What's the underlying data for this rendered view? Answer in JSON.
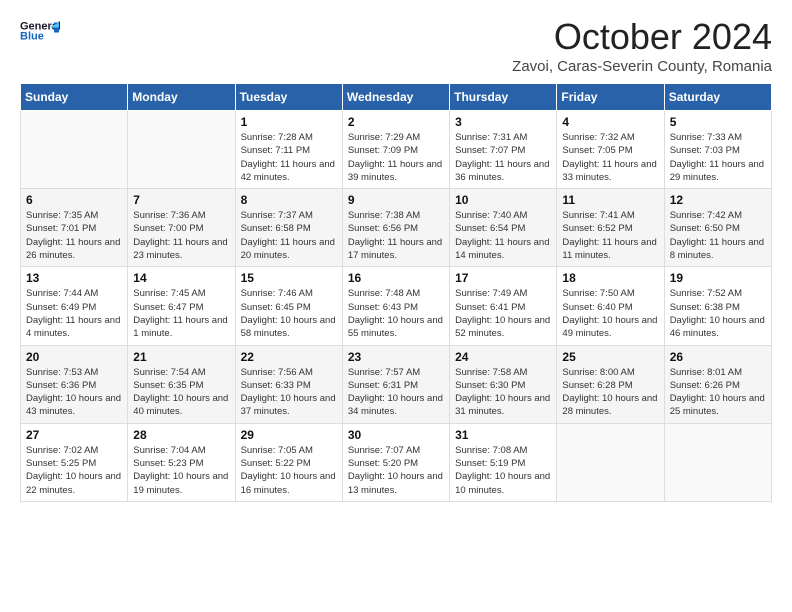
{
  "header": {
    "logo_general": "General",
    "logo_blue": "Blue",
    "month_title": "October 2024",
    "location": "Zavoi, Caras-Severin County, Romania"
  },
  "days_of_week": [
    "Sunday",
    "Monday",
    "Tuesday",
    "Wednesday",
    "Thursday",
    "Friday",
    "Saturday"
  ],
  "weeks": [
    [
      {
        "day": "",
        "sunrise": "",
        "sunset": "",
        "daylight": ""
      },
      {
        "day": "",
        "sunrise": "",
        "sunset": "",
        "daylight": ""
      },
      {
        "day": "1",
        "sunrise": "Sunrise: 7:28 AM",
        "sunset": "Sunset: 7:11 PM",
        "daylight": "Daylight: 11 hours and 42 minutes."
      },
      {
        "day": "2",
        "sunrise": "Sunrise: 7:29 AM",
        "sunset": "Sunset: 7:09 PM",
        "daylight": "Daylight: 11 hours and 39 minutes."
      },
      {
        "day": "3",
        "sunrise": "Sunrise: 7:31 AM",
        "sunset": "Sunset: 7:07 PM",
        "daylight": "Daylight: 11 hours and 36 minutes."
      },
      {
        "day": "4",
        "sunrise": "Sunrise: 7:32 AM",
        "sunset": "Sunset: 7:05 PM",
        "daylight": "Daylight: 11 hours and 33 minutes."
      },
      {
        "day": "5",
        "sunrise": "Sunrise: 7:33 AM",
        "sunset": "Sunset: 7:03 PM",
        "daylight": "Daylight: 11 hours and 29 minutes."
      }
    ],
    [
      {
        "day": "6",
        "sunrise": "Sunrise: 7:35 AM",
        "sunset": "Sunset: 7:01 PM",
        "daylight": "Daylight: 11 hours and 26 minutes."
      },
      {
        "day": "7",
        "sunrise": "Sunrise: 7:36 AM",
        "sunset": "Sunset: 7:00 PM",
        "daylight": "Daylight: 11 hours and 23 minutes."
      },
      {
        "day": "8",
        "sunrise": "Sunrise: 7:37 AM",
        "sunset": "Sunset: 6:58 PM",
        "daylight": "Daylight: 11 hours and 20 minutes."
      },
      {
        "day": "9",
        "sunrise": "Sunrise: 7:38 AM",
        "sunset": "Sunset: 6:56 PM",
        "daylight": "Daylight: 11 hours and 17 minutes."
      },
      {
        "day": "10",
        "sunrise": "Sunrise: 7:40 AM",
        "sunset": "Sunset: 6:54 PM",
        "daylight": "Daylight: 11 hours and 14 minutes."
      },
      {
        "day": "11",
        "sunrise": "Sunrise: 7:41 AM",
        "sunset": "Sunset: 6:52 PM",
        "daylight": "Daylight: 11 hours and 11 minutes."
      },
      {
        "day": "12",
        "sunrise": "Sunrise: 7:42 AM",
        "sunset": "Sunset: 6:50 PM",
        "daylight": "Daylight: 11 hours and 8 minutes."
      }
    ],
    [
      {
        "day": "13",
        "sunrise": "Sunrise: 7:44 AM",
        "sunset": "Sunset: 6:49 PM",
        "daylight": "Daylight: 11 hours and 4 minutes."
      },
      {
        "day": "14",
        "sunrise": "Sunrise: 7:45 AM",
        "sunset": "Sunset: 6:47 PM",
        "daylight": "Daylight: 11 hours and 1 minute."
      },
      {
        "day": "15",
        "sunrise": "Sunrise: 7:46 AM",
        "sunset": "Sunset: 6:45 PM",
        "daylight": "Daylight: 10 hours and 58 minutes."
      },
      {
        "day": "16",
        "sunrise": "Sunrise: 7:48 AM",
        "sunset": "Sunset: 6:43 PM",
        "daylight": "Daylight: 10 hours and 55 minutes."
      },
      {
        "day": "17",
        "sunrise": "Sunrise: 7:49 AM",
        "sunset": "Sunset: 6:41 PM",
        "daylight": "Daylight: 10 hours and 52 minutes."
      },
      {
        "day": "18",
        "sunrise": "Sunrise: 7:50 AM",
        "sunset": "Sunset: 6:40 PM",
        "daylight": "Daylight: 10 hours and 49 minutes."
      },
      {
        "day": "19",
        "sunrise": "Sunrise: 7:52 AM",
        "sunset": "Sunset: 6:38 PM",
        "daylight": "Daylight: 10 hours and 46 minutes."
      }
    ],
    [
      {
        "day": "20",
        "sunrise": "Sunrise: 7:53 AM",
        "sunset": "Sunset: 6:36 PM",
        "daylight": "Daylight: 10 hours and 43 minutes."
      },
      {
        "day": "21",
        "sunrise": "Sunrise: 7:54 AM",
        "sunset": "Sunset: 6:35 PM",
        "daylight": "Daylight: 10 hours and 40 minutes."
      },
      {
        "day": "22",
        "sunrise": "Sunrise: 7:56 AM",
        "sunset": "Sunset: 6:33 PM",
        "daylight": "Daylight: 10 hours and 37 minutes."
      },
      {
        "day": "23",
        "sunrise": "Sunrise: 7:57 AM",
        "sunset": "Sunset: 6:31 PM",
        "daylight": "Daylight: 10 hours and 34 minutes."
      },
      {
        "day": "24",
        "sunrise": "Sunrise: 7:58 AM",
        "sunset": "Sunset: 6:30 PM",
        "daylight": "Daylight: 10 hours and 31 minutes."
      },
      {
        "day": "25",
        "sunrise": "Sunrise: 8:00 AM",
        "sunset": "Sunset: 6:28 PM",
        "daylight": "Daylight: 10 hours and 28 minutes."
      },
      {
        "day": "26",
        "sunrise": "Sunrise: 8:01 AM",
        "sunset": "Sunset: 6:26 PM",
        "daylight": "Daylight: 10 hours and 25 minutes."
      }
    ],
    [
      {
        "day": "27",
        "sunrise": "Sunrise: 7:02 AM",
        "sunset": "Sunset: 5:25 PM",
        "daylight": "Daylight: 10 hours and 22 minutes."
      },
      {
        "day": "28",
        "sunrise": "Sunrise: 7:04 AM",
        "sunset": "Sunset: 5:23 PM",
        "daylight": "Daylight: 10 hours and 19 minutes."
      },
      {
        "day": "29",
        "sunrise": "Sunrise: 7:05 AM",
        "sunset": "Sunset: 5:22 PM",
        "daylight": "Daylight: 10 hours and 16 minutes."
      },
      {
        "day": "30",
        "sunrise": "Sunrise: 7:07 AM",
        "sunset": "Sunset: 5:20 PM",
        "daylight": "Daylight: 10 hours and 13 minutes."
      },
      {
        "day": "31",
        "sunrise": "Sunrise: 7:08 AM",
        "sunset": "Sunset: 5:19 PM",
        "daylight": "Daylight: 10 hours and 10 minutes."
      },
      {
        "day": "",
        "sunrise": "",
        "sunset": "",
        "daylight": ""
      },
      {
        "day": "",
        "sunrise": "",
        "sunset": "",
        "daylight": ""
      }
    ]
  ]
}
